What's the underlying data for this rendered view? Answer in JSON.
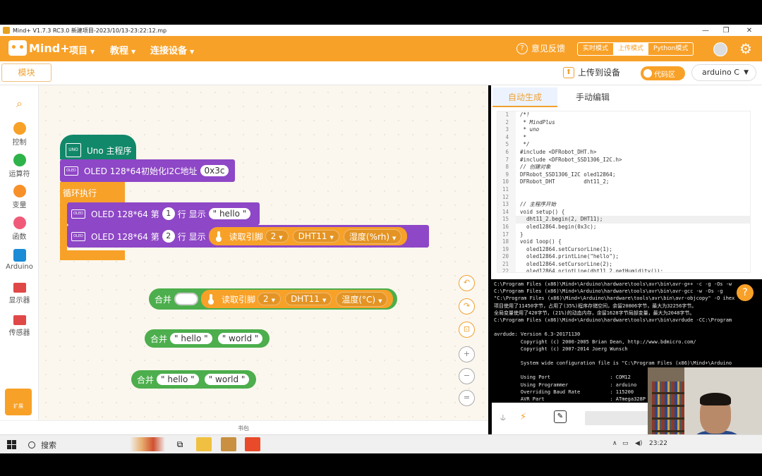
{
  "window": {
    "title": "Mind+ V1.7.3 RC3.0  新建项目-2023/10/13-23:22:12.mp"
  },
  "menubar": {
    "logo": "Mind+",
    "items": [
      "项目",
      "教程",
      "连接设备"
    ],
    "feedback": "意见反馈",
    "modes": [
      "实时模式",
      "上传模式",
      "Python模式"
    ],
    "active_mode": "上传模式"
  },
  "toolbar": {
    "modules_tab": "模块",
    "upload": "上传到设备",
    "code_area": "代码区",
    "board": "arduino C"
  },
  "sidebar": {
    "categories": [
      {
        "label": "控制",
        "color": "#f8a128"
      },
      {
        "label": "运算符",
        "color": "#2eb34a"
      },
      {
        "label": "变量",
        "color": "#f8902a"
      },
      {
        "label": "函数",
        "color": "#f05a78"
      },
      {
        "label": "Arduino",
        "color": "#1a8bd6"
      },
      {
        "label": "显示器",
        "color": "#e04848"
      },
      {
        "label": "传感器",
        "color": "#e04848"
      }
    ],
    "expand": "扩展"
  },
  "blocks": {
    "hat": "Uno 主程序",
    "oled_init": "OLED 128*64初始化I2C地址",
    "oled_addr": "0x3c",
    "loop": "循环执行",
    "show1_prefix": "OLED 128*64 第",
    "show1_line": "1",
    "show1_mid": "行 显示",
    "show1_text": "hello",
    "show2_prefix": "OLED 128*64 第",
    "show2_line": "2",
    "show2_mid": "行 显示",
    "read_pin": "读取引脚",
    "pin": "2",
    "sensor": "DHT11",
    "humidity": "湿度(%rh)",
    "join": "合并",
    "temperature": "温度(°C)",
    "join_a": "hello",
    "join_b": "world",
    "bottom_label": "书包"
  },
  "code_panel": {
    "tab_auto": "自动生成",
    "tab_manual": "手动编辑",
    "lines": [
      {
        "n": "1",
        "t": "/*!"
      },
      {
        "n": "2",
        "t": " * MindPlus"
      },
      {
        "n": "3",
        "t": " * uno"
      },
      {
        "n": "4",
        "t": " *"
      },
      {
        "n": "5",
        "t": " */"
      },
      {
        "n": "6",
        "t": "#include <DFRobot_DHT.h>"
      },
      {
        "n": "7",
        "t": "#include <DFRobot_SSD1306_I2C.h>"
      },
      {
        "n": "8",
        "t": "// 创建对象"
      },
      {
        "n": "9",
        "t": "DFRobot_SSD1306_I2C oled12864;"
      },
      {
        "n": "10",
        "t": "DFRobot_DHT         dht11_2;"
      },
      {
        "n": "11",
        "t": ""
      },
      {
        "n": "12",
        "t": ""
      },
      {
        "n": "13",
        "t": "// 主程序开始"
      },
      {
        "n": "14",
        "t": "void setup() {"
      },
      {
        "n": "15",
        "t": "  dht11_2.begin(2, DHT11);"
      },
      {
        "n": "16",
        "t": "  oled12864.begin(0x3c);"
      },
      {
        "n": "17",
        "t": "}"
      },
      {
        "n": "18",
        "t": "void loop() {"
      },
      {
        "n": "19",
        "t": "  oled12864.setCursorLine(1);"
      },
      {
        "n": "20",
        "t": "  oled12864.printLine(\"hello\");"
      },
      {
        "n": "21",
        "t": "  oled12864.setCursorLine(2);"
      },
      {
        "n": "22",
        "t": "  oled12864.printLine(dht11_2.getHumidity());"
      }
    ]
  },
  "terminal": {
    "lines": [
      "C:\\Program Files (x86)\\Mind+\\Arduino\\hardware\\tools\\avr\\bin\\avr-g++ -c -g -Os -w",
      "C:\\Program Files (x86)\\Mind+\\Arduino\\hardware\\tools\\avr\\bin\\avr-gcc -w -Os -g",
      "\"C:\\Program Files (x86)\\Mind+\\Arduino\\hardware\\tools\\avr\\bin\\avr-objcopy\" -O ihex",
      "项目使用了11450字节，占用了(35%)程序存储空间，余留20806字节，最大为32256字节。",
      "全局变量使用了420字节，(21%)的动态内存，余留1628字节局部变量，最大为2048字节。",
      "C:\\Program Files (x86)\\Mind+\\Arduino\\hardware\\tools\\avr\\bin\\avrdude -CC:\\Program",
      "",
      "avrdude: Version 6.3-20171130",
      "         Copyright (c) 2000-2005 Brian Dean, http://www.bdmicro.com/",
      "         Copyright (c) 2007-2014 Joerg Wunsch",
      "",
      "         System wide configuration file is \"C:\\Program Files (x86)\\Mind+\\Arduino",
      "",
      "         Using Port                    : COM12",
      "         Using Programmer              : arduino",
      "         Overriding Baud Rate          : 115200",
      "         AVR Part                      : ATmega328P"
    ]
  },
  "taskbar": {
    "search": "搜索",
    "time": "23:22"
  }
}
